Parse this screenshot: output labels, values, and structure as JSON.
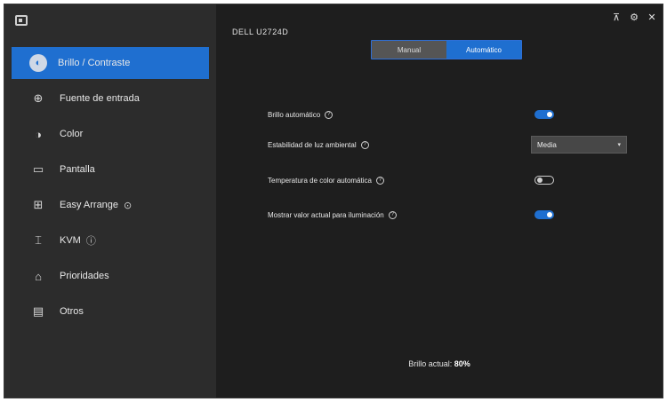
{
  "sidebar": {
    "items": [
      {
        "label": "Brillo / Contraste",
        "icon": "brightness-icon",
        "glyph": "◐",
        "active": true,
        "suffix": ""
      },
      {
        "label": "Fuente de entrada",
        "icon": "input-source-icon",
        "glyph": "⊕",
        "active": false,
        "suffix": ""
      },
      {
        "label": "Color",
        "icon": "color-icon",
        "glyph": "◑",
        "active": false,
        "suffix": ""
      },
      {
        "label": "Pantalla",
        "icon": "display-icon",
        "glyph": "▭",
        "active": false,
        "suffix": ""
      },
      {
        "label": "Easy Arrange",
        "icon": "easy-arrange-icon",
        "glyph": "⊞",
        "active": false,
        "suffix": "⊙"
      },
      {
        "label": "KVM",
        "icon": "kvm-icon",
        "glyph": "⌶",
        "active": false,
        "suffix": "ⓘ"
      },
      {
        "label": "Prioridades",
        "icon": "home-icon",
        "glyph": "⌂",
        "active": false,
        "suffix": ""
      },
      {
        "label": "Otros",
        "icon": "others-icon",
        "glyph": "▤",
        "active": false,
        "suffix": ""
      }
    ]
  },
  "main": {
    "title": "DELL U2724D",
    "tabs": [
      {
        "label": "Manual",
        "active": false
      },
      {
        "label": "Automático",
        "active": true
      }
    ],
    "settings": [
      {
        "label": "Brillo automático",
        "help": "?",
        "control": "toggle",
        "on": true
      },
      {
        "label": "Estabilidad de luz ambiental",
        "help": "?",
        "control": "select",
        "value": "Media"
      },
      {
        "label": "Temperatura de color automática",
        "help": "?",
        "control": "toggle",
        "on": false
      },
      {
        "label": "Mostrar valor actual para iluminación",
        "help": "?",
        "control": "toggle",
        "on": true
      }
    ],
    "footer_label": "Brillo actual:",
    "footer_value": "80%"
  },
  "window_controls": {
    "pin": "⊼",
    "settings": "⚙",
    "close": "✕"
  }
}
